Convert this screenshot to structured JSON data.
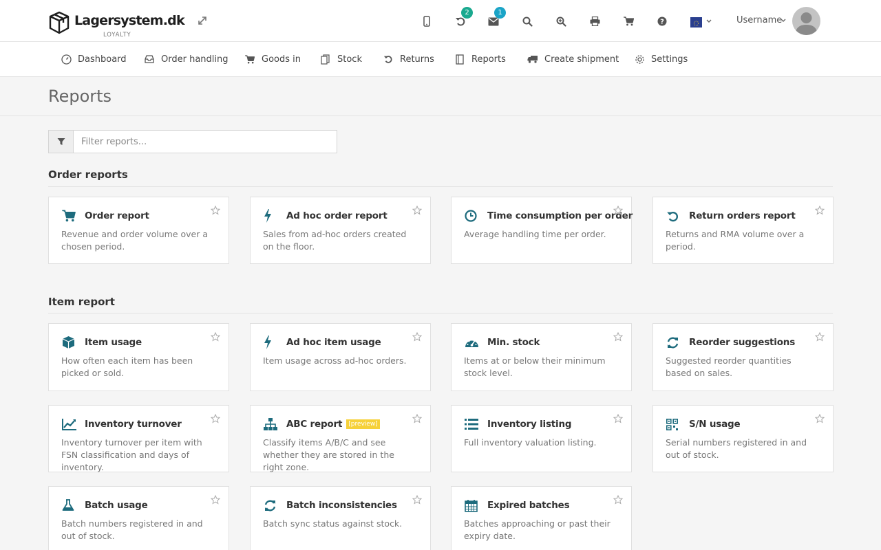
{
  "brand": {
    "name": "Lagersystem.dk",
    "tagline": "LOYALTY"
  },
  "topbar": {
    "returns_badge": "2",
    "messages_badge": "1",
    "language": "EU",
    "username": "Username"
  },
  "nav": {
    "items": [
      {
        "label": "Dashboard",
        "icon": "dashboard-icon"
      },
      {
        "label": "Order handling",
        "icon": "inbox-icon"
      },
      {
        "label": "Goods in",
        "icon": "cart-icon"
      },
      {
        "label": "Stock",
        "icon": "copy-icon"
      },
      {
        "label": "Returns",
        "icon": "undo-icon"
      },
      {
        "label": "Reports",
        "icon": "file-icon"
      },
      {
        "label": "Create shipment",
        "icon": "truck-icon"
      },
      {
        "label": "Settings",
        "icon": "gear-icon"
      }
    ]
  },
  "page": {
    "title": "Reports"
  },
  "filter": {
    "placeholder": "Filter reports..."
  },
  "sections": [
    {
      "title": "Order reports",
      "cards": [
        {
          "title": "Order report",
          "desc": "Revenue and order volume over a chosen period.",
          "icon": "cart-icon"
        },
        {
          "title": "Ad hoc order report",
          "desc": "Sales from ad-hoc orders created on the floor.",
          "icon": "bolt-icon"
        },
        {
          "title": "Time consumption per order",
          "desc": "Average handling time per order.",
          "icon": "clock-icon"
        },
        {
          "title": "Return orders report",
          "desc": "Returns and RMA volume over a period.",
          "icon": "undo-icon"
        }
      ]
    },
    {
      "title": "Item report",
      "cards": [
        {
          "title": "Item usage",
          "desc": "How often each item has been picked or sold.",
          "icon": "cube-icon"
        },
        {
          "title": "Ad hoc item usage",
          "desc": "Item usage across ad-hoc orders.",
          "icon": "bolt-icon"
        },
        {
          "title": "Min. stock",
          "desc": "Items at or below their minimum stock level.",
          "icon": "gauge-icon"
        },
        {
          "title": "Reorder suggestions",
          "desc": "Suggested reorder quantities based on sales.",
          "icon": "refresh-icon"
        },
        {
          "title": "Inventory turnover",
          "desc": "Inventory turnover per item with FSN classification and days of inventory.",
          "icon": "line-chart-icon"
        },
        {
          "title": "ABC report",
          "badge": "[preview]",
          "desc": "Classify items A/B/C and see whether they are stored in the right zone.",
          "icon": "sitemap-icon"
        },
        {
          "title": "Inventory listing",
          "desc": "Full inventory valuation listing.",
          "icon": "list-icon"
        },
        {
          "title": "S/N usage",
          "desc": "Serial numbers registered in and out of stock.",
          "icon": "qrcode-icon"
        },
        {
          "title": "Batch usage",
          "desc": "Batch numbers registered in and out of stock.",
          "icon": "flask-icon"
        },
        {
          "title": "Batch inconsistencies",
          "desc": "Batch sync status against stock.",
          "icon": "refresh-icon"
        },
        {
          "title": "Expired batches",
          "desc": "Batches approaching or past their expiry date.",
          "icon": "calendar-icon"
        }
      ]
    }
  ],
  "colors": {
    "accent": "#1d6b7d",
    "badge_teal": "#1aa98f",
    "badge_cyan": "#1ba4c7",
    "preview": "#f6d13a"
  }
}
